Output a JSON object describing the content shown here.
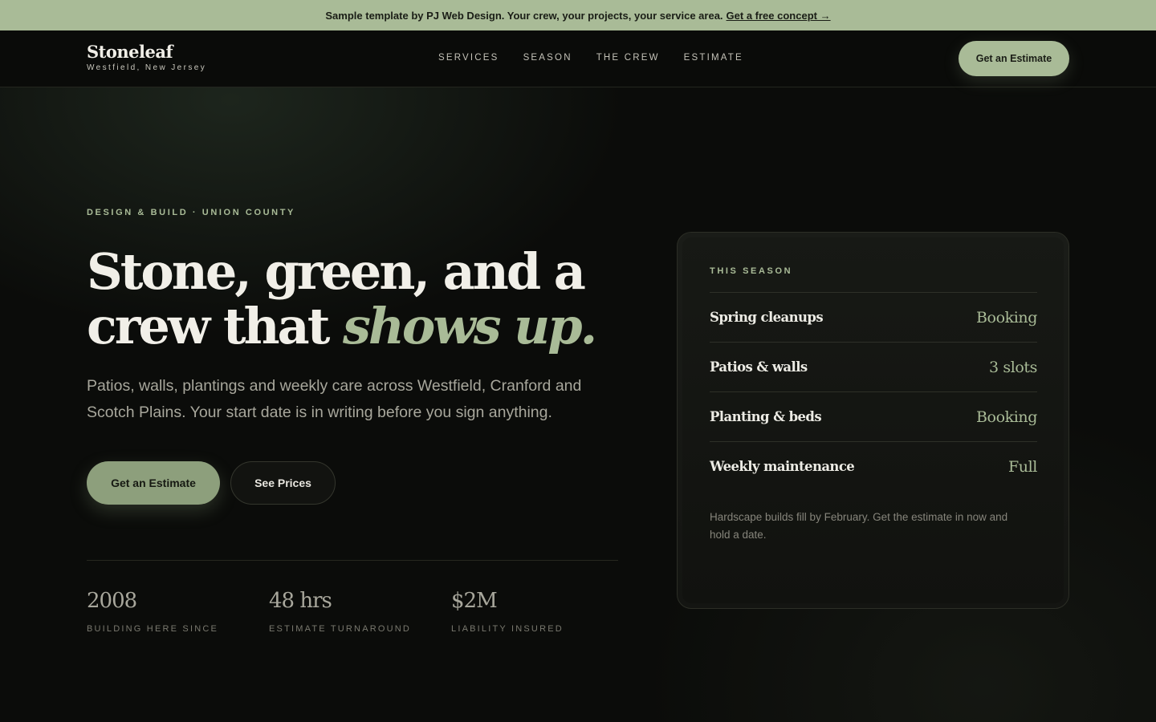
{
  "announcement": {
    "text": "Sample template by PJ Web Design. Your crew, your projects, your service area.",
    "link_label": "Get a free concept →"
  },
  "header": {
    "brand_name": "Stoneleaf",
    "brand_location": "Westfield, New Jersey",
    "nav": [
      "SERVICES",
      "SEASON",
      "THE CREW",
      "ESTIMATE"
    ],
    "cta_label": "Get an Estimate"
  },
  "hero": {
    "eyebrow": "DESIGN & BUILD · UNION COUNTY",
    "headline_line1": "Stone, green, and a",
    "headline_line2_plain": "crew that ",
    "headline_line2_accent": "shows up.",
    "lede": "Patios, walls, plantings and weekly care across Westfield, Cranford and Scotch Plains. Your start date is in writing before you sign anything.",
    "primary_cta": "Get an Estimate",
    "secondary_cta": "See Prices"
  },
  "stats": [
    {
      "value": "2008",
      "label": "BUILDING HERE SINCE"
    },
    {
      "value": "48 hrs",
      "label": "ESTIMATE TURNAROUND"
    },
    {
      "value": "$2M",
      "label": "LIABILITY INSURED"
    }
  ],
  "season_card": {
    "eyebrow": "THIS SEASON",
    "rows": [
      {
        "name": "Spring cleanups",
        "status": "Booking"
      },
      {
        "name": "Patios & walls",
        "status": "3 slots"
      },
      {
        "name": "Planting & beds",
        "status": "Booking"
      },
      {
        "name": "Weekly maintenance",
        "status": "Full"
      }
    ],
    "note": "Hardscape builds fill by February. Get the estimate in now and hold a date."
  },
  "colors": {
    "accent": "#a9bb97",
    "background": "#0b0c0a",
    "button_primary": "#8d9f7c"
  }
}
